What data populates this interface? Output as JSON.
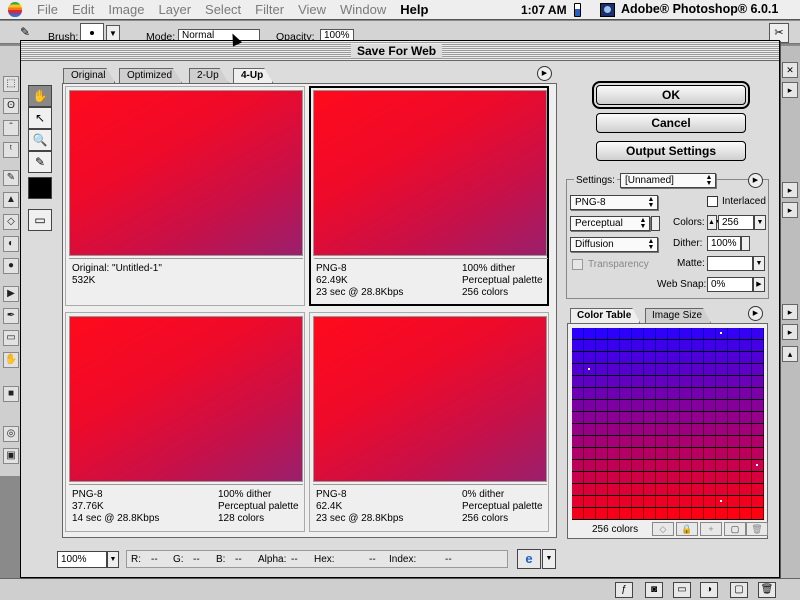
{
  "menubar": {
    "items": [
      {
        "label": "File"
      },
      {
        "label": "Edit"
      },
      {
        "label": "Image"
      },
      {
        "label": "Layer"
      },
      {
        "label": "Select"
      },
      {
        "label": "Filter"
      },
      {
        "label": "View"
      },
      {
        "label": "Window"
      },
      {
        "label": "Help"
      }
    ],
    "clock": "1:07 AM",
    "app_name": "Adobe® Photoshop® 6.0.1"
  },
  "options_bar": {
    "brush_label": "Brush:",
    "mode_label": "Mode:",
    "mode_value": "Normal",
    "opacity_label": "Opacity:",
    "opacity_value": "100%"
  },
  "dialog": {
    "title": "Save For Web",
    "tabs": [
      {
        "label": "Original"
      },
      {
        "label": "Optimized"
      },
      {
        "label": "2-Up"
      },
      {
        "label": "4-Up"
      }
    ],
    "active_tab": "4-Up",
    "panes": [
      {
        "line1_left": "Original: \"Untitled-1\"",
        "line2_left": "532K",
        "line3_left": "",
        "line1_right": "",
        "line2_right": "",
        "line3_right": ""
      },
      {
        "line1_left": "PNG-8",
        "line2_left": "62.49K",
        "line3_left": "23 sec @ 28.8Kbps",
        "line1_right": "100% dither",
        "line2_right": "Perceptual palette",
        "line3_right": "256 colors"
      },
      {
        "line1_left": "PNG-8",
        "line2_left": "37.76K",
        "line3_left": "14 sec @ 28.8Kbps",
        "line1_right": "100% dither",
        "line2_right": "Perceptual palette",
        "line3_right": "128 colors"
      },
      {
        "line1_left": "PNG-8",
        "line2_left": "62.4K",
        "line3_left": "23 sec @ 28.8Kbps",
        "line1_right": "0% dither",
        "line2_right": "Perceptual palette",
        "line3_right": "256 colors"
      }
    ],
    "buttons": {
      "ok": "OK",
      "cancel": "Cancel",
      "output_settings": "Output Settings"
    },
    "settings": {
      "label": "Settings:",
      "preset": "[Unnamed]",
      "format": "PNG-8",
      "interlaced_label": "Interlaced",
      "reduction": "Perceptual",
      "colors_label": "Colors:",
      "colors_value": "256",
      "dither_algo": "Diffusion",
      "dither_label": "Dither:",
      "dither_value": "100%",
      "transparency_label": "Transparency",
      "matte_label": "Matte:",
      "matte_value": "",
      "websnap_label": "Web Snap:",
      "websnap_value": "0%"
    },
    "color_table": {
      "tabs": [
        {
          "label": "Color Table"
        },
        {
          "label": "Image Size"
        }
      ],
      "count": "256 colors",
      "colors": {
        "top": "#2a00ff",
        "bottom": "#ff0010"
      }
    },
    "readout": {
      "zoom": "100%",
      "r_label": "R:",
      "r_value": "--",
      "g_label": "G:",
      "g_value": "--",
      "b_label": "B:",
      "b_value": "--",
      "alpha_label": "Alpha:",
      "alpha_value": "--",
      "hex_label": "Hex:",
      "hex_value": "--",
      "index_label": "Index:",
      "index_value": "--"
    }
  }
}
